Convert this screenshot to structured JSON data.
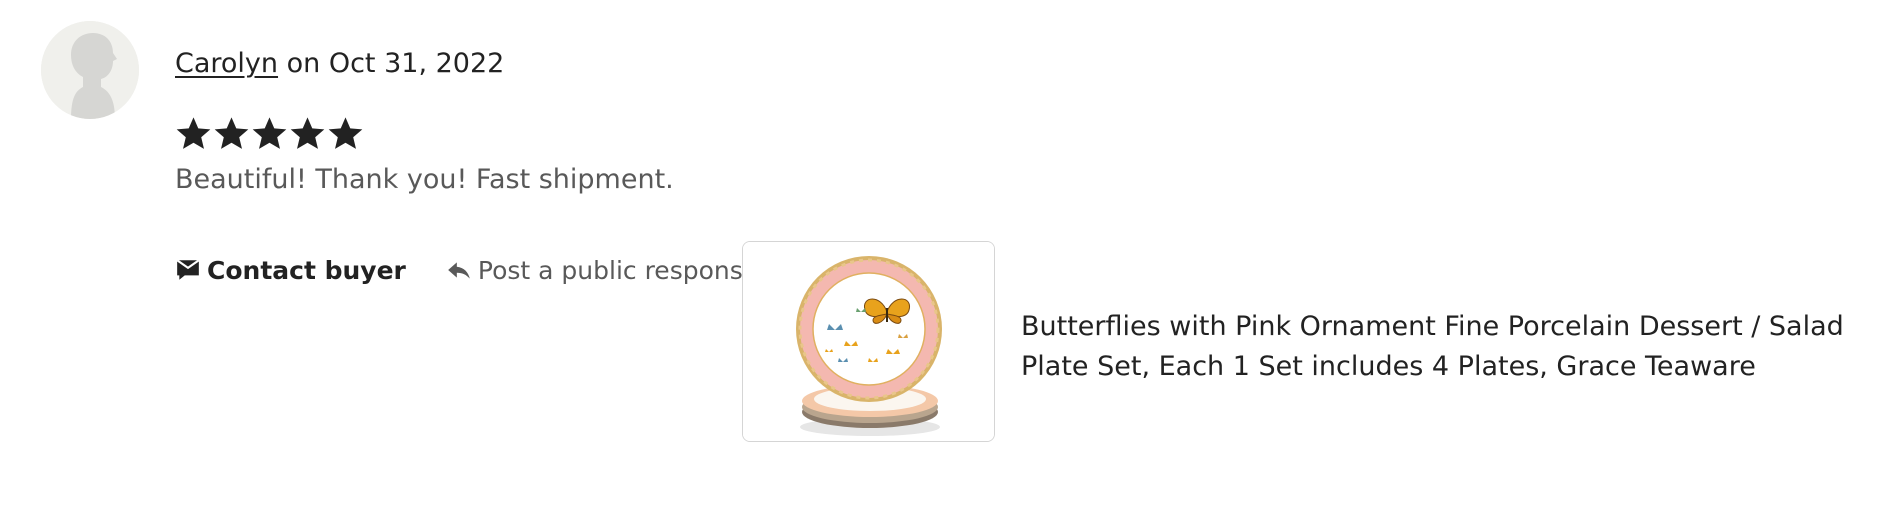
{
  "review": {
    "reviewer_name": "Carolyn",
    "date_text": " on Oct 31, 2022",
    "rating": 5,
    "rating_max": 5,
    "text": "Beautiful! Thank you! Fast shipment."
  },
  "actions": {
    "contact_buyer_label": "Contact buyer",
    "public_response_label": "Post a public response"
  },
  "product": {
    "title": "Butterflies with Pink Ornament Fine Porcelain Dessert / Salad Plate Set, Each 1 Set includes 4 Plates, Grace Teaware"
  },
  "icons": {
    "avatar": "default-avatar-icon",
    "star": "star-icon",
    "contact": "message-icon",
    "reply": "reply-arrow-icon"
  },
  "colors": {
    "text_primary": "#222222",
    "text_secondary": "#595959",
    "star": "#222222",
    "avatar_bg": "#f0f0ec",
    "plate_rim": "#f4b8b0",
    "butterfly": "#e8a21c"
  }
}
